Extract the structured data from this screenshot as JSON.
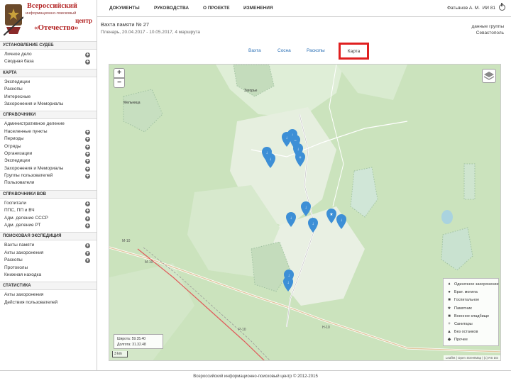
{
  "logo": {
    "line1": "Всероссийский",
    "line2": "информационно-поисковый",
    "line3": "центр",
    "line4": "«Отечество»"
  },
  "topnav": {
    "items": [
      "ДОКУМЕНТЫ",
      "РУКОВОДСТВА",
      "О ПРОЕКТЕ",
      "ИЗМЕНЕНИЯ"
    ],
    "user": "Фатьянов А. М.",
    "count": "ИИ 81"
  },
  "header": {
    "title": "Вахта памяти № 27",
    "subtitle": "Пленарь, 20.04.2017 - 10.05.2017, 4 маршрута",
    "right_line1": "данные группы",
    "right_line2": "Севастополь"
  },
  "tabs": [
    "Вахта",
    "Сосна",
    "Раскопы",
    "Карта"
  ],
  "sidebar": {
    "sections": [
      {
        "title": "УСТАНОВЛЕНИЕ СУДЕБ",
        "items": [
          {
            "label": "Личное дело",
            "plus": true
          },
          {
            "label": "Сводная база",
            "plus": true
          }
        ]
      },
      {
        "title": "КАРТА",
        "items": [
          {
            "label": "Экспедиции",
            "plus": false
          },
          {
            "label": "Раскопы",
            "plus": false
          },
          {
            "label": "Интересные",
            "plus": false
          },
          {
            "label": "Захоронения и Мемориалы",
            "plus": false
          }
        ]
      },
      {
        "title": "СПРАВОЧНИКИ",
        "items": [
          {
            "label": "Административное деление",
            "plus": false
          },
          {
            "label": "Населенные пункты",
            "plus": true
          },
          {
            "label": "Периоды",
            "plus": true
          },
          {
            "label": "Отряды",
            "plus": true
          },
          {
            "label": "Организации",
            "plus": true
          },
          {
            "label": "Экспедиции",
            "plus": true
          },
          {
            "label": "Захоронения и Мемориалы",
            "plus": true
          },
          {
            "label": "Группы пользователей",
            "plus": true
          },
          {
            "label": "Пользователи",
            "plus": false
          }
        ]
      },
      {
        "title": "СПРАВОЧНИКИ ВОВ",
        "items": [
          {
            "label": "Госпитали",
            "plus": true
          },
          {
            "label": "ППС, ПП и ВЧ",
            "plus": true
          },
          {
            "label": "Адм. деление СССР",
            "plus": true
          },
          {
            "label": "Адм. деление РТ",
            "plus": true
          }
        ]
      },
      {
        "title": "ПОИСКОВАЯ ЭКСПЕДИЦИЯ",
        "items": [
          {
            "label": "Вахты памяти",
            "plus": true
          },
          {
            "label": "Акты захоронения",
            "plus": true
          },
          {
            "label": "Раскопы",
            "plus": true
          },
          {
            "label": "Протоколы",
            "plus": false
          },
          {
            "label": "Книжная находка",
            "plus": false
          }
        ]
      },
      {
        "title": "СТАТИСТИКА",
        "items": [
          {
            "label": "Акты захоронения",
            "plus": false
          },
          {
            "label": "Действия пользователей",
            "plus": false
          }
        ]
      }
    ]
  },
  "map": {
    "zoom_in": "+",
    "zoom_out": "−",
    "coords_line1": "Широта: 59.35.40",
    "coords_line2": "Долгота: 31.32.48",
    "scale": "3 km",
    "attribution": "Leaflet | Open StreetMap | (c) RS DS",
    "place_labels": [
      "Загорье",
      "Мельница",
      "М-10",
      "М-10",
      "Р-10",
      "Н-10"
    ],
    "legend": [
      {
        "icon": "drop-icon",
        "sym": "♦",
        "label": "Одиночное захоронение"
      },
      {
        "icon": "circle-icon",
        "sym": "●",
        "label": "Брат. могила"
      },
      {
        "icon": "square-icon",
        "sym": "■",
        "label": "Госпитальное"
      },
      {
        "icon": "star-icon",
        "sym": "★",
        "label": "Памятник"
      },
      {
        "icon": "square-icon",
        "sym": "■",
        "label": "Военное кладбище"
      },
      {
        "icon": "plus-icon",
        "sym": "+",
        "label": "Санитары"
      },
      {
        "icon": "triangle-icon",
        "sym": "▲",
        "label": "Без останков"
      },
      {
        "icon": "diamond-icon",
        "sym": "◆",
        "label": "Прочее"
      }
    ]
  },
  "footer": {
    "text": "Всероссийский информационно-поисковый центр © 2012-2015"
  },
  "colors": {
    "accent": "#2a6fb5",
    "highlight": "#e02020",
    "marker": "#3d8fd6",
    "map_green": "#cbe3bd",
    "water": "#aad3df"
  }
}
